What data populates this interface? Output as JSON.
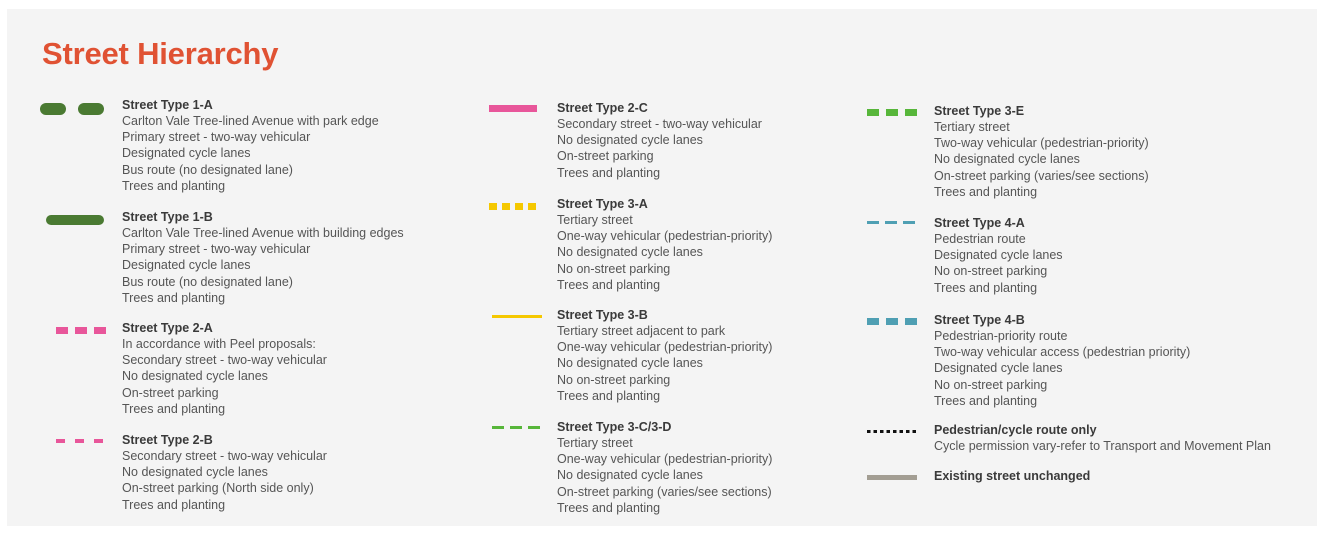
{
  "title": "Street Hierarchy",
  "legend": [
    {
      "id": "1a",
      "name": "Street Type 1-A",
      "color": "#4a7a32",
      "style": "long-dash-thick",
      "lines": [
        "Carlton Vale Tree-lined Avenue with park edge",
        "Primary street - two-way vehicular",
        "Designated cycle lanes",
        "Bus route (no designated lane)",
        "Trees and planting"
      ]
    },
    {
      "id": "1b",
      "name": "Street Type 1-B",
      "color": "#4a7a32",
      "style": "solid-thick-rounded",
      "lines": [
        "Carlton Vale Tree-lined Avenue with building edges",
        "Primary street - two-way vehicular",
        "Designated cycle lanes",
        "Bus route (no designated lane)",
        "Trees and planting"
      ]
    },
    {
      "id": "2a",
      "name": "Street Type 2-A",
      "color": "#e8569a",
      "style": "dash-thick",
      "lines": [
        "In accordance with Peel proposals:",
        "Secondary street - two-way vehicular",
        "No designated cycle lanes",
        "On-street parking",
        "Trees and planting"
      ]
    },
    {
      "id": "2b",
      "name": "Street Type 2-B",
      "color": "#e8569a",
      "style": "dash-thin",
      "lines": [
        "Secondary street - two-way vehicular",
        "No designated cycle lanes",
        "On-street parking (North side only)",
        "Trees and planting"
      ]
    },
    {
      "id": "2c",
      "name": "Street Type 2-C",
      "color": "#e8569a",
      "style": "solid",
      "lines": [
        "Secondary street - two-way vehicular",
        "No designated cycle lanes",
        "On-street parking",
        "Trees and planting"
      ]
    },
    {
      "id": "3a",
      "name": "Street Type 3-A",
      "color": "#f5c800",
      "style": "dash-square",
      "lines": [
        "Tertiary street",
        "One-way vehicular (pedestrian-priority)",
        "No designated cycle lanes",
        "No on-street parking",
        "Trees and planting"
      ]
    },
    {
      "id": "3b",
      "name": "Street Type 3-B",
      "color": "#f5c800",
      "style": "solid-thin",
      "lines": [
        "Tertiary street adjacent to park",
        "One-way vehicular (pedestrian-priority)",
        "No designated cycle lanes",
        "No on-street parking",
        "Trees and planting"
      ]
    },
    {
      "id": "3cd",
      "name": "Street Type 3-C/3-D",
      "color": "#57b63a",
      "style": "dash-thin",
      "lines": [
        "Tertiary street",
        "One-way vehicular (pedestrian-priority)",
        "No designated cycle lanes",
        "On-street parking (varies/see sections)",
        "Trees and planting"
      ]
    },
    {
      "id": "3e",
      "name": "Street Type 3-E",
      "color": "#57b63a",
      "style": "dash-thick",
      "lines": [
        "Tertiary street",
        "Two-way vehicular (pedestrian-priority)",
        "No designated cycle lanes",
        "On-street parking (varies/see sections)",
        "Trees and planting"
      ]
    },
    {
      "id": "4a",
      "name": "Street Type 4-A",
      "color": "#4f9fb3",
      "style": "dash-thin",
      "lines": [
        "Pedestrian route",
        "Designated cycle lanes",
        "No on-street parking",
        "Trees and planting"
      ]
    },
    {
      "id": "4b",
      "name": "Street Type 4-B",
      "color": "#4f9fb3",
      "style": "dash-thick",
      "lines": [
        "Pedestrian-priority route",
        "Two-way vehicular access (pedestrian priority)",
        "Designated cycle lanes",
        "No on-street parking",
        "Trees and planting"
      ]
    },
    {
      "id": "ped",
      "name": "Pedestrian/cycle route only",
      "color": "#111111",
      "style": "dotted",
      "lines": [
        "Cycle permission vary-refer to Transport and Movement Plan"
      ]
    },
    {
      "id": "ex",
      "name": "Existing street unchanged",
      "color": "#a39e93",
      "style": "solid-grey",
      "lines": []
    }
  ]
}
